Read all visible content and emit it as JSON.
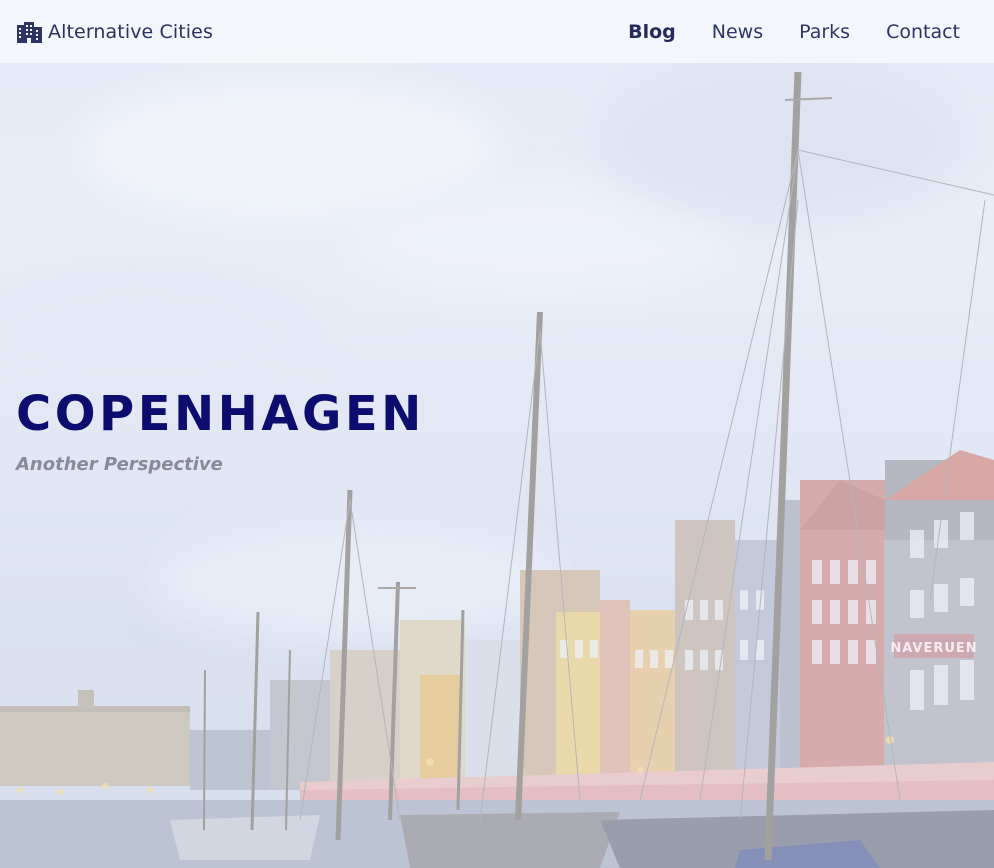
{
  "header": {
    "brand": {
      "icon": "building-icon",
      "label": "Alternative Cities"
    },
    "nav": [
      {
        "label": "Blog",
        "active": true
      },
      {
        "label": "News",
        "active": false
      },
      {
        "label": "Parks",
        "active": false
      },
      {
        "label": "Contact",
        "active": false
      }
    ]
  },
  "hero": {
    "title": "COPENHAGEN",
    "subtitle": "Another Perspective",
    "background_image": "harbour-photo-nyhavn",
    "storefront_sign": "NAVERUEN"
  },
  "colors": {
    "title": "#0c0d6e",
    "nav_text": "#2d3565",
    "subtitle": "#8a8a96",
    "nav_background": "#f4f6fa"
  }
}
